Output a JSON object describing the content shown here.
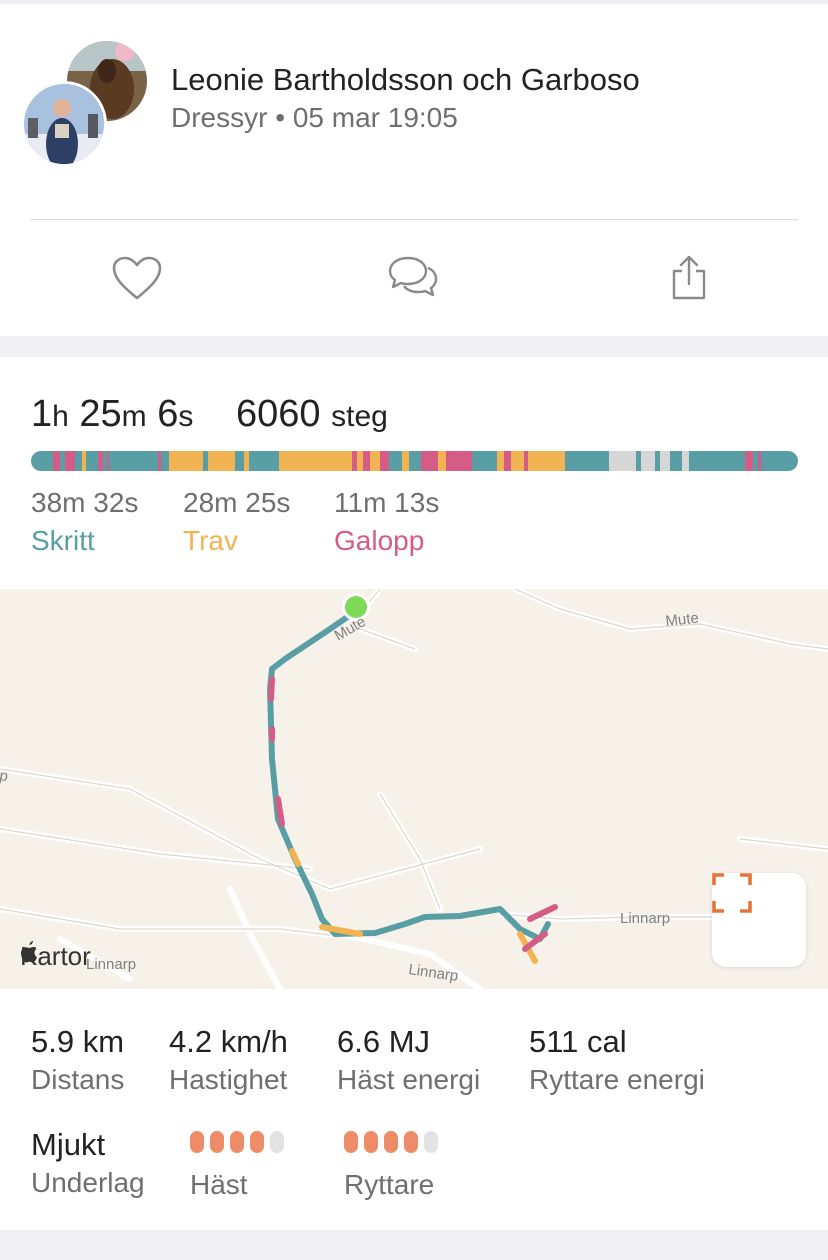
{
  "header": {
    "name": "Leonie Bartholdsson och Garboso",
    "discipline": "Dressyr",
    "separator": "•",
    "datetime": "05 mar 19:05"
  },
  "actions": {
    "like_icon": "heart-icon",
    "comment_icon": "comment-bubbles-icon",
    "share_icon": "share-icon"
  },
  "session": {
    "duration": {
      "h": "1",
      "h_unit": "h",
      "m": "25",
      "m_unit": "m",
      "s": "6",
      "s_unit": "s"
    },
    "steps": "6060",
    "steps_unit": "steg"
  },
  "gaits": [
    {
      "time": "38m 32s",
      "label": "Skritt",
      "color": "#5a9ea5"
    },
    {
      "time": "28m 25s",
      "label": "Trav",
      "color": "#f2b352"
    },
    {
      "time": "11m 13s",
      "label": "Galopp",
      "color": "#d45c86"
    }
  ],
  "colors": {
    "walk": "#5a9ea5",
    "trot": "#f2b352",
    "canter": "#d45c86",
    "idle": "#d6d6d6",
    "accent": "#e8743b",
    "dot_on": "#ed8c66",
    "dot_off": "#e3e3e3"
  },
  "map": {
    "brand": "Kartor",
    "road_labels": [
      "Mute",
      "Mute",
      "Linnarp",
      "Linnarp",
      "Linnarp",
      "rp"
    ],
    "expand_icon": "expand-icon"
  },
  "stats": [
    {
      "value": "5.9 km",
      "label": "Distans"
    },
    {
      "value": "4.2 km/h",
      "label": "Hastighet"
    },
    {
      "value": "6.6 MJ",
      "label": "Häst energi"
    },
    {
      "value": "511 cal",
      "label": "Ryttare energi"
    }
  ],
  "surface": {
    "value": "Mjukt",
    "label": "Underlag"
  },
  "ratings": [
    {
      "label": "Häst",
      "score": 4,
      "max": 5
    },
    {
      "label": "Ryttare",
      "score": 4,
      "max": 5
    }
  ]
}
